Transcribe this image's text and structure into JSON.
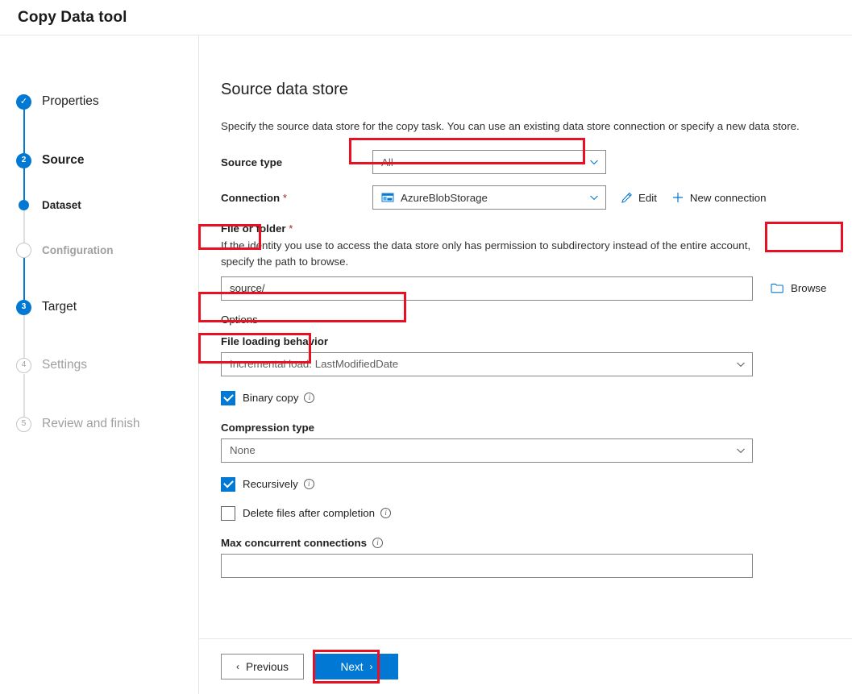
{
  "window": {
    "title": "Copy Data tool"
  },
  "wizard": {
    "steps": [
      {
        "id": "properties",
        "label": "Properties",
        "marker": "check",
        "state": "completed"
      },
      {
        "id": "source",
        "label": "Source",
        "marker": "2",
        "state": "current"
      },
      {
        "id": "dataset",
        "label": "Dataset",
        "marker": "dot",
        "state": "active-sub"
      },
      {
        "id": "configuration",
        "label": "Configuration",
        "marker": "hollow",
        "state": "disabled"
      },
      {
        "id": "target",
        "label": "Target",
        "marker": "3",
        "state": "upcoming"
      },
      {
        "id": "settings",
        "label": "Settings",
        "marker": "4",
        "state": "disabled"
      },
      {
        "id": "review",
        "label": "Review and finish",
        "marker": "5",
        "state": "disabled"
      }
    ]
  },
  "page": {
    "title": "Source data store",
    "description": "Specify the source data store for the copy task. You can use an existing data store connection or specify a new data store."
  },
  "form": {
    "source_type": {
      "label": "Source type",
      "value": "All"
    },
    "connection": {
      "label": "Connection",
      "required_marker": "*",
      "value": "AzureBlobStorage",
      "icon": "azure-blob-storage-icon",
      "edit_label": "Edit",
      "edit_icon": "pencil-icon",
      "new_connection_label": "New connection",
      "new_connection_icon": "plus-icon"
    },
    "file_or_folder": {
      "label": "File or folder",
      "required_marker": "*",
      "help": "If the identity you use to access the data store only has permission to subdirectory instead of the entire account, specify the path to browse.",
      "value": "source/",
      "browse_label": "Browse",
      "browse_icon": "folder-icon"
    },
    "options_label": "Options",
    "file_loading_behavior": {
      "label": "File loading behavior",
      "value": "Incremental load: LastModifiedDate"
    },
    "binary_copy": {
      "label": "Binary copy",
      "checked": true,
      "info_icon": "info-icon"
    },
    "compression_type": {
      "label": "Compression type",
      "value": "None"
    },
    "recursively": {
      "label": "Recursively",
      "checked": true,
      "info_icon": "info-icon"
    },
    "delete_files": {
      "label": "Delete files after completion",
      "checked": false,
      "info_icon": "info-icon"
    },
    "max_concurrent_connections": {
      "label": "Max concurrent connections",
      "value": "",
      "info_icon": "info-icon"
    }
  },
  "footer": {
    "previous_label": "Previous",
    "previous_glyph": "‹",
    "next_label": "Next",
    "next_glyph": "›"
  },
  "colors": {
    "accent": "#0078d4",
    "highlight": "#e81123",
    "required": "#a4262c",
    "disabled_text": "#a19f9d"
  }
}
